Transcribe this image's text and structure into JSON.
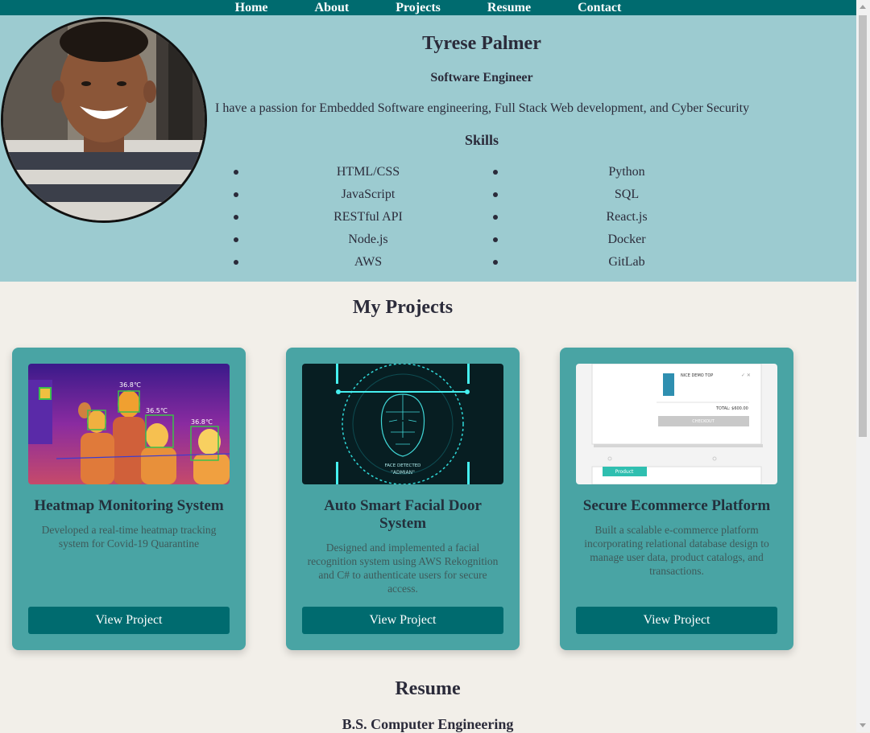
{
  "nav": {
    "items": [
      "Home",
      "About",
      "Projects",
      "Resume",
      "Contact"
    ]
  },
  "hero": {
    "name": "Tyrese Palmer",
    "role": "Software Engineer",
    "bio": "I have a passion for Embedded Software engineering, Full Stack Web development, and Cyber Security",
    "skills_title": "Skills",
    "skills_left": [
      "HTML/CSS",
      "JavaScript",
      "RESTful API",
      "Node.js",
      "AWS"
    ],
    "skills_right": [
      "Python",
      "SQL",
      "React.js",
      "Docker",
      "GitLab"
    ]
  },
  "projects": {
    "title": "My Projects",
    "cards": [
      {
        "title": "Heatmap Monitoring System",
        "desc": "Developed a real-time heatmap tracking system for Covid-19 Quarantine",
        "button": "View Project",
        "thumb_labels": [
          "36.8℃",
          "36.5℃",
          "36.8℃"
        ]
      },
      {
        "title": "Auto Smart Facial Door System",
        "desc": "Designed and implemented a facial recognition system using AWS Rekognition and C# to authenticate users for secure access.",
        "button": "View Project",
        "thumb_labels": [
          "FACE DETECTED",
          "\"ADMIAN\""
        ]
      },
      {
        "title": "Secure Ecommerce Platform",
        "desc": "Built a scalable e-commerce platform incorporating relational database design to manage user data, product catalogs, and transactions.",
        "button": "View Project",
        "thumb_labels": [
          "NICE DEMO TOP",
          "TOTAL: $600.00",
          "CHECKOUT",
          "Product"
        ]
      }
    ]
  },
  "resume": {
    "title": "Resume",
    "degree": "B.S. Computer Engineering"
  }
}
